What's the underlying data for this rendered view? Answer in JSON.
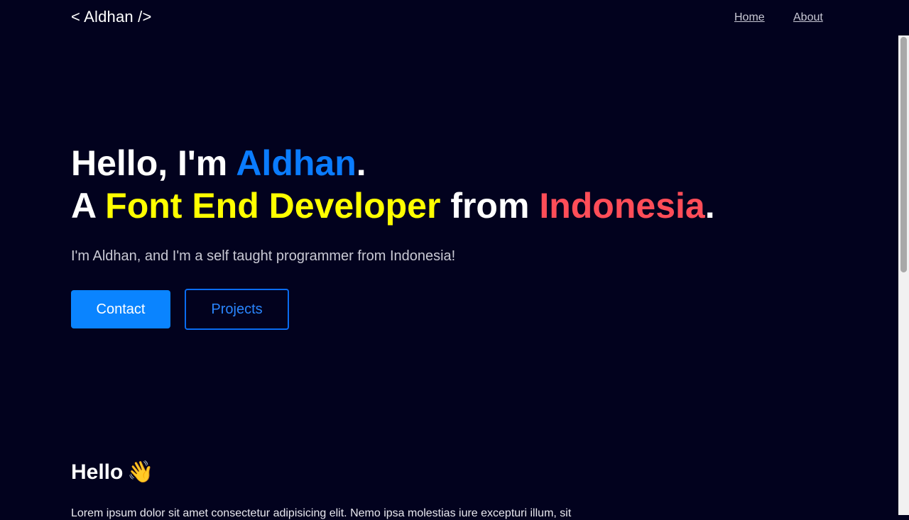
{
  "nav": {
    "brand": "< Aldhan />",
    "links": [
      "Home",
      "About"
    ]
  },
  "hero": {
    "line1": {
      "prefix": "Hello, I'm ",
      "name": "Aldhan",
      "suffix": "."
    },
    "line2": {
      "prefix": "A ",
      "role": "Font End Developer",
      "middle": " from ",
      "country": "Indonesia",
      "suffix": "."
    },
    "subtitle": "I'm Aldhan, and I'm a self taught programmer from Indonesia!",
    "buttons": {
      "contact": "Contact",
      "projects": "Projects"
    }
  },
  "about": {
    "heading": "Hello",
    "wave_icon": "👋",
    "body": "Lorem ipsum dolor sit amet consectetur adipisicing elit. Nemo ipsa molestias iure excepturi illum, sit"
  },
  "colors": {
    "background": "#02021e",
    "accent_blue": "#0a7cff",
    "accent_yellow": "#ffff00",
    "accent_red": "#ff4d58",
    "button_primary": "#0a84ff"
  }
}
